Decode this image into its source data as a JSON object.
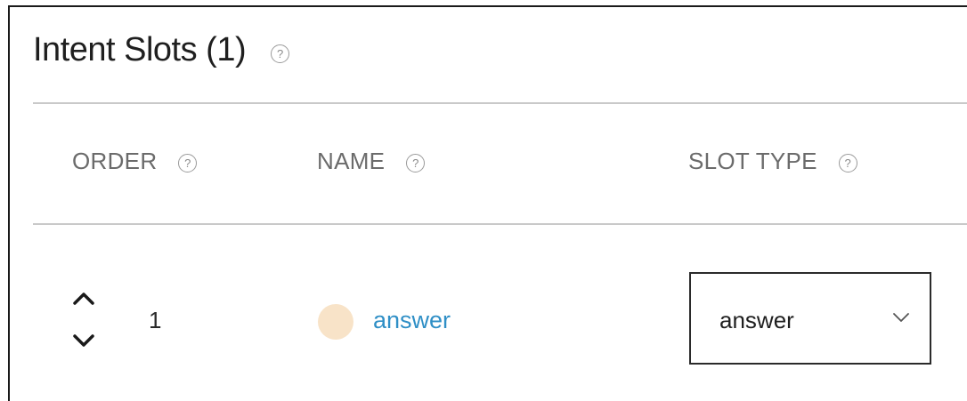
{
  "section": {
    "title": "Intent Slots (1)",
    "help_glyph": "?"
  },
  "columns": {
    "order": "ORDER",
    "name": "NAME",
    "slot_type": "SLOT TYPE"
  },
  "rows": [
    {
      "order": "1",
      "name": "answer",
      "slot_type": "answer"
    }
  ],
  "colors": {
    "link": "#2f8fc6",
    "slot_dot": "#f8e3c8",
    "header_text": "#6b6b6b",
    "divider": "#c9c9c9"
  },
  "icons": {
    "title_help": "help-circle-icon",
    "order_help": "help-circle-icon",
    "name_help": "help-circle-icon",
    "slot_type_help": "help-circle-icon",
    "move_up": "chevron-up-icon",
    "move_down": "chevron-down-icon",
    "select_chevron": "chevron-down-icon"
  }
}
